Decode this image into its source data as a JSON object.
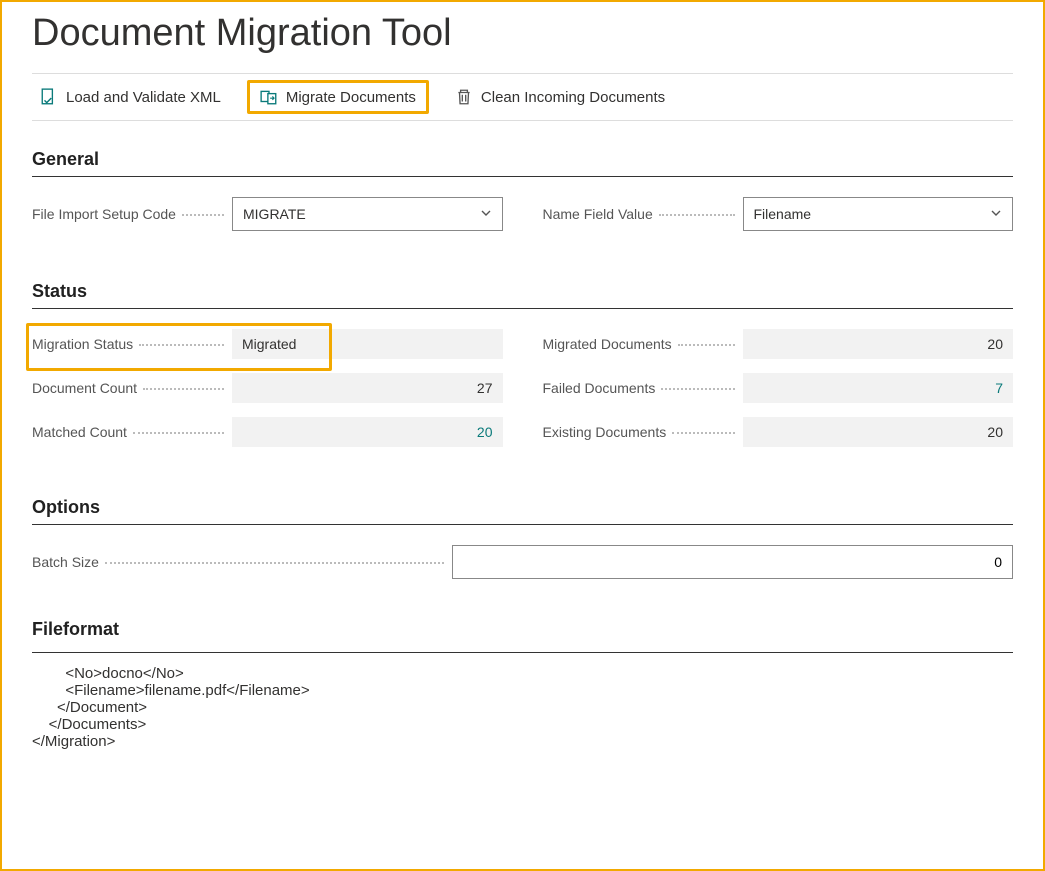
{
  "page_title": "Document Migration Tool",
  "toolbar": {
    "load_validate_label": "Load and Validate XML",
    "migrate_label": "Migrate Documents",
    "clean_label": "Clean Incoming Documents"
  },
  "sections": {
    "general_header": "General",
    "status_header": "Status",
    "options_header": "Options",
    "fileformat_header": "Fileformat"
  },
  "general": {
    "file_import_setup_label": "File Import Setup Code",
    "file_import_setup_value": "MIGRATE",
    "name_field_label": "Name Field Value",
    "name_field_value": "Filename"
  },
  "status": {
    "migration_status_label": "Migration Status",
    "migration_status_value": "Migrated",
    "document_count_label": "Document Count",
    "document_count_value": "27",
    "matched_count_label": "Matched Count",
    "matched_count_value": "20",
    "migrated_docs_label": "Migrated Documents",
    "migrated_docs_value": "20",
    "failed_docs_label": "Failed Documents",
    "failed_docs_value": "7",
    "existing_docs_label": "Existing Documents",
    "existing_docs_value": "20"
  },
  "options": {
    "batch_size_label": "Batch Size",
    "batch_size_value": "0"
  },
  "fileformat": {
    "content": "        <No>docno</No>\n        <Filename>filename.pdf</Filename>\n      </Document>\n    </Documents>\n</Migration>"
  }
}
